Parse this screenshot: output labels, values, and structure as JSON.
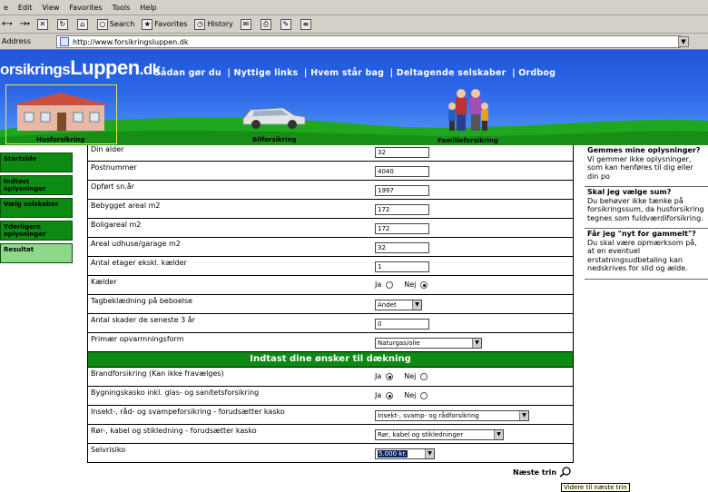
{
  "menu": [
    "e",
    "Edit",
    "View",
    "Favorites",
    "Tools",
    "Help"
  ],
  "toolbar": {
    "back": "←",
    "forward": "→",
    "search": "Search",
    "favorites": "Favorites",
    "history": "History"
  },
  "address": {
    "label": "Address",
    "url": "http://www.forsikringsluppen.dk"
  },
  "brand": {
    "part1": "orsikrings",
    "part2": "Luppen",
    "part3": ".dk"
  },
  "topnav": [
    "Sådan gør du",
    "Nyttige links",
    "Hvem står bag",
    "Deltagende selskaber",
    "Ordbog"
  ],
  "captions": {
    "house": "Husforsikring",
    "car": "Bilforsikring",
    "family": "Familieforsikring"
  },
  "sidebar": [
    {
      "label": "Startside",
      "light": false
    },
    {
      "label": "Indtast oplysninger",
      "light": false
    },
    {
      "label": "Vælg selskaber",
      "light": false
    },
    {
      "label": "Yderligere oplysninger",
      "light": false
    },
    {
      "label": "Resultat",
      "light": true
    }
  ],
  "form": {
    "rows1": [
      {
        "label": "Din alder",
        "value": "32"
      },
      {
        "label": "Postnummer",
        "value": "4040"
      },
      {
        "label": "Opført sn.år",
        "value": "1997"
      },
      {
        "label": "Bebygget areal m2",
        "value": "172"
      },
      {
        "label": "Boligareal m2",
        "value": "172"
      },
      {
        "label": "Areal udhuse/garage m2",
        "value": "32"
      },
      {
        "label": "Antal etager ekskl. kælder",
        "value": "1"
      }
    ],
    "kaelder": {
      "label": "Kælder",
      "ja": "Ja",
      "nej": "Nej"
    },
    "tag": {
      "label": "Tagbeklædning på beboelse",
      "value": "Andet"
    },
    "skader": {
      "label": "Antal skader de seneste 3 år",
      "value": "0"
    },
    "opvarmning": {
      "label": "Primær opvarmningsform",
      "value": "Naturgas/olie"
    },
    "section2": "Indtast dine ønsker til dækning",
    "brand_ins": {
      "label": "Brandforsikring (Kan ikke fravælges)",
      "ja": "Ja",
      "nej": "Nej"
    },
    "bygning": {
      "label": "Bygningskasko inkl. glas- og sanitetsforsikring",
      "ja": "Ja",
      "nej": "Nej"
    },
    "insekt": {
      "label": "Insekt-, råd- og svampeforsikring - forudsætter kasko",
      "value": "Insekt-, svamp- og rådforsikring"
    },
    "roer": {
      "label": "Rør-, kabel og stikledning - forudsætter kasko",
      "value": "Rør, kabel og stikledninger"
    },
    "selvrisiko": {
      "label": "Selvrisiko",
      "value": "5.000 kr."
    }
  },
  "info": [
    {
      "q": "Gemmes mine oplysninger?",
      "a": "Vi gemmer ikke oplysninger, som kan henføres til dig eller din po"
    },
    {
      "q": "Skal jeg vælge sum?",
      "a": "Du behøver ikke tænke på forsikringssum, da husforsikring tegnes som fuldværdiforsikring."
    },
    {
      "q": "Får jeg \"nyt for gammelt\"?",
      "a": "Du skal være opmærksom på, at en eventuel erstatningsudbetaling kan nedskrives for slid og ælde."
    }
  ],
  "next": {
    "label": "Næste trin",
    "tooltip": "Videre til næste trin"
  },
  "colors": {
    "green": "#0c8a12",
    "sky": "#2e68e8",
    "grass": "#1fa81f"
  }
}
